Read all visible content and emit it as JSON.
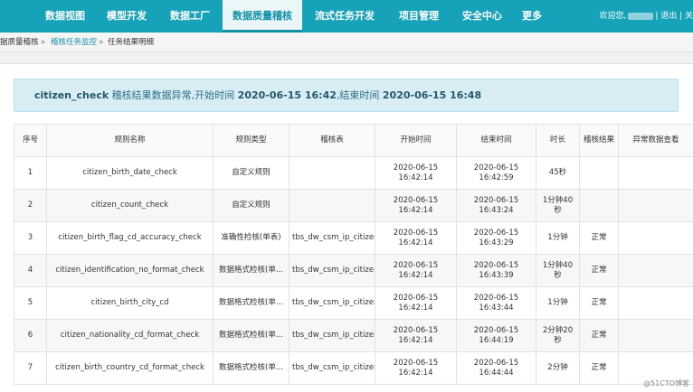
{
  "nav": {
    "items": [
      {
        "label": "数据视图"
      },
      {
        "label": "模型开发"
      },
      {
        "label": "数据工厂"
      },
      {
        "label": "数据质量稽核"
      },
      {
        "label": "流式任务开发"
      },
      {
        "label": "项目管理"
      },
      {
        "label": "安全中心"
      },
      {
        "label": "更多"
      }
    ],
    "active_index": 3,
    "welcome": "欢迎您,",
    "logout": "| 退出 | 关"
  },
  "breadcrumb": {
    "root": "据质量稽核",
    "sep1": "»",
    "link": "稽核任务监控",
    "sep2": "»",
    "current": "任务结果明细"
  },
  "alert": {
    "job_name": "citizen_check",
    "text1": " 稽核结果数据异常,开始时间 ",
    "start": "2020-06-15 16:42",
    "text2": ",结束时间 ",
    "end": "2020-06-15 16:48"
  },
  "table": {
    "headers": {
      "seq": "序号",
      "rule_name": "规则名称",
      "rule_type": "规则类型",
      "audit_table": "稽核表",
      "start_time": "开始时间",
      "end_time": "结束时间",
      "duration": "时长",
      "result": "稽核结果",
      "view_abnormal": "异常数据查看"
    },
    "rows": [
      {
        "seq": "1",
        "rule_name": "citizen_birth_date_check",
        "rule_type": "自定义规则",
        "audit_table": "",
        "start_time": "2020-06-15 16:42:14",
        "end_time": "2020-06-15 16:42:59",
        "duration": "45秒",
        "result": "",
        "view": ""
      },
      {
        "seq": "2",
        "rule_name": "citizen_count_check",
        "rule_type": "自定义规则",
        "audit_table": "",
        "start_time": "2020-06-15 16:42:14",
        "end_time": "2020-06-15 16:43:24",
        "duration": "1分钟40秒",
        "result": "",
        "view": ""
      },
      {
        "seq": "3",
        "rule_name": "citizen_birth_flag_cd_accuracy_check",
        "rule_type": "准确性检核(单表)",
        "audit_table": "tbs_dw_csm_ip_citizen",
        "start_time": "2020-06-15 16:42:14",
        "end_time": "2020-06-15 16:43:29",
        "duration": "1分钟",
        "result": "正常",
        "view": ""
      },
      {
        "seq": "4",
        "rule_name": "citizen_identification_no_format_check",
        "rule_type": "数据格式检核(单...",
        "audit_table": "tbs_dw_csm_ip_citizen",
        "start_time": "2020-06-15 16:42:14",
        "end_time": "2020-06-15 16:43:39",
        "duration": "1分钟40秒",
        "result": "正常",
        "view": ""
      },
      {
        "seq": "5",
        "rule_name": "citizen_birth_city_cd",
        "rule_type": "数据格式检核(单...",
        "audit_table": "tbs_dw_csm_ip_citizen",
        "start_time": "2020-06-15 16:42:14",
        "end_time": "2020-06-15 16:43:44",
        "duration": "1分钟",
        "result": "正常",
        "view": ""
      },
      {
        "seq": "6",
        "rule_name": "citizen_nationality_cd_format_check",
        "rule_type": "数据格式检核(单...",
        "audit_table": "tbs_dw_csm_ip_citizen",
        "start_time": "2020-06-15 16:42:14",
        "end_time": "2020-06-15 16:44:19",
        "duration": "2分钟20秒",
        "result": "正常",
        "view": ""
      },
      {
        "seq": "7",
        "rule_name": "citizen_birth_country_cd_format_check",
        "rule_type": "数据格式检核(单...",
        "audit_table": "tbs_dw_csm_ip_citizen",
        "start_time": "2020-06-15 16:42:14",
        "end_time": "2020-06-15 16:44:44",
        "duration": "2分钟",
        "result": "正常",
        "view": ""
      }
    ]
  },
  "watermark": "@51CTO博客"
}
